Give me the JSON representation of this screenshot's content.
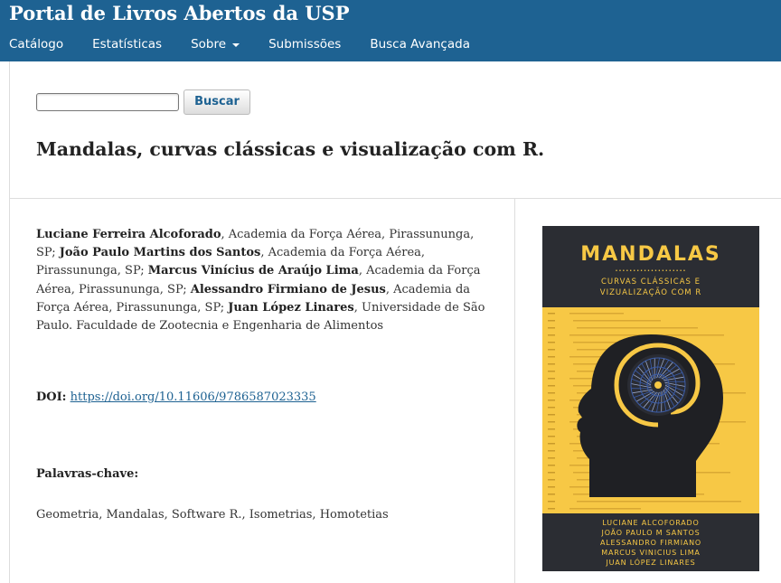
{
  "header": {
    "site_title": "Portal de Livros Abertos da USP",
    "nav": [
      {
        "label": "Catálogo"
      },
      {
        "label": "Estatísticas"
      },
      {
        "label": "Sobre"
      },
      {
        "label": "Submissões"
      },
      {
        "label": "Busca Avançada"
      }
    ],
    "background_color": "#1e6292"
  },
  "search": {
    "value": "",
    "button_label": "Buscar"
  },
  "book": {
    "title": "Mandalas, curvas clássicas e visualização com R.",
    "authors": [
      {
        "name": "Luciane Ferreira Alcoforado",
        "affiliation": ", Academia da Força Aérea, Pirassununga, SP; "
      },
      {
        "name": "João Paulo Martins dos Santos",
        "affiliation": ", Academia da Força Aérea, Pirassununga, SP; "
      },
      {
        "name": "Marcus Vinícius de Araújo Lima",
        "affiliation": ", Academia da Força Aérea, Pirassununga, SP; "
      },
      {
        "name": "Alessandro Firmiano de Jesus",
        "affiliation": ", Academia da Força Aérea, Pirassununga, SP; "
      },
      {
        "name": "Juan López Linares",
        "affiliation": ", Universidade de São Paulo. Faculdade de Zootecnia e Engenharia de Alimentos"
      }
    ],
    "doi_label": "DOI:",
    "doi_url": "https://doi.org/10.11606/9786587023335",
    "keywords_label": "Palavras-chave:",
    "keywords": "Geometria, Mandalas, Software R., Isometrias, Homotetias"
  },
  "cover": {
    "title": "MANDALAS",
    "dots": "••••••••••••••••••••",
    "subtitle_line1": "CURVAS CLÁSSICAS E",
    "subtitle_line2": "VIZUALIZAÇÃO COM R",
    "authors": [
      "LUCIANE ALCOFORADO",
      "JOÃO PAULO M SANTOS",
      "ALESSANDRO FIRMIANO",
      "MARCUS VINICIUS LIMA",
      "JUAN LÓPEZ LINARES"
    ],
    "colors": {
      "dark": "#2b2d33",
      "yellow": "#f7c845",
      "mandala": "#3c5da8"
    }
  }
}
